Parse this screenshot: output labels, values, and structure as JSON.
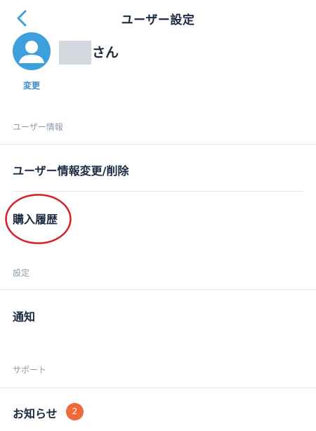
{
  "header": {
    "title": "ユーザー設定"
  },
  "profile": {
    "name_suffix": "さん",
    "change_label": "変更"
  },
  "sections": {
    "user_info": {
      "title": "ユーザー情報",
      "items": [
        "ユーザー情報変更/削除",
        "購入履歴"
      ]
    },
    "settings": {
      "title": "設定",
      "items": [
        "通知"
      ]
    },
    "support": {
      "title": "サポート",
      "items": [
        "お知らせ"
      ],
      "badge": "2"
    }
  },
  "colors": {
    "accent": "#3da0dc",
    "text": "#1a2a40",
    "muted": "#8e9aa8",
    "badge": "#ef6a3a",
    "highlight": "#d81f26"
  },
  "icons": {
    "back": "chevron-left-icon",
    "avatar": "user-icon"
  }
}
